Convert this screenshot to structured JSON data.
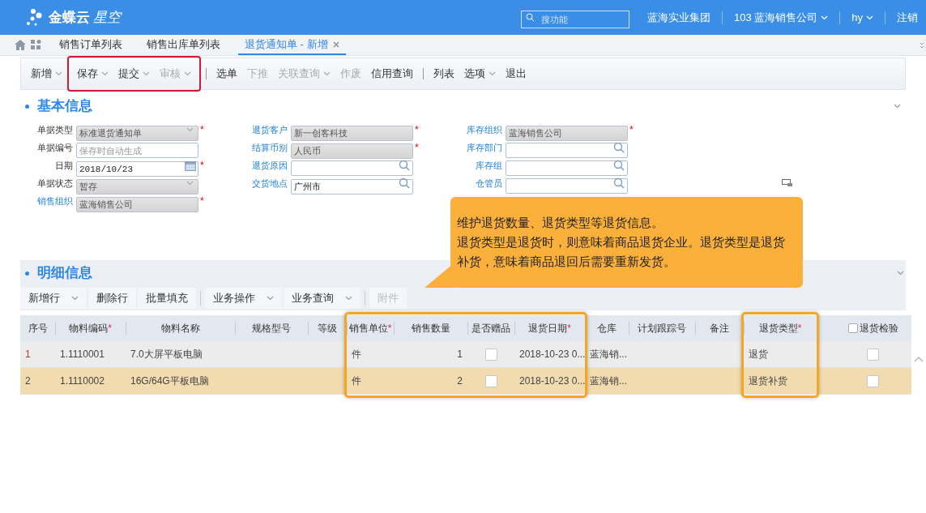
{
  "topbar": {
    "brand": "金蝶云",
    "brand_suffix": "星空",
    "search": {
      "placeholder": "搜功能"
    },
    "group": "蓝海实业集团",
    "org": "103 蓝海销售公司",
    "user": "hy",
    "logout": "注销"
  },
  "tabs": [
    {
      "label": "销售订单列表",
      "selected": false,
      "closable": false
    },
    {
      "label": "销售出库单列表",
      "selected": false,
      "closable": false
    },
    {
      "label": "退货通知单 - 新增",
      "selected": true,
      "closable": true
    }
  ],
  "toolbar": [
    {
      "buttons": [
        {
          "label": "新增",
          "dropdown": true,
          "disabled": false,
          "highlighted": false
        },
        {
          "label": "保存",
          "dropdown": true,
          "disabled": false,
          "highlighted": true
        },
        {
          "label": "提交",
          "dropdown": true,
          "disabled": false,
          "highlighted": true
        },
        {
          "label": "审核",
          "dropdown": true,
          "disabled": true,
          "highlighted": true
        }
      ]
    },
    {
      "buttons": [
        {
          "label": "选单",
          "dropdown": false,
          "disabled": false,
          "highlighted": false
        },
        {
          "label": "下推",
          "dropdown": false,
          "disabled": true,
          "highlighted": false
        },
        {
          "label": "关联查询",
          "dropdown": true,
          "disabled": true,
          "highlighted": false
        },
        {
          "label": "作废",
          "dropdown": false,
          "disabled": true,
          "highlighted": false
        },
        {
          "label": "信用查询",
          "dropdown": false,
          "disabled": false,
          "highlighted": false
        }
      ]
    },
    {
      "buttons": [
        {
          "label": "列表",
          "dropdown": false,
          "disabled": false,
          "highlighted": false
        },
        {
          "label": "选项",
          "dropdown": true,
          "disabled": false,
          "highlighted": false
        },
        {
          "label": "退出",
          "dropdown": false,
          "disabled": false,
          "highlighted": false
        }
      ]
    }
  ],
  "basic_section": {
    "title": "基本信息",
    "columns": [
      [
        {
          "label": "单据类型",
          "link": false,
          "kind": "select",
          "value": "标准退货通知单",
          "disabled": true,
          "required_mark": "*"
        },
        {
          "label": "单据编号",
          "link": false,
          "kind": "text",
          "placeholder": "保存时自动生成",
          "disabled": false
        },
        {
          "label": "日期",
          "link": false,
          "kind": "date",
          "value": "2018/10/23",
          "disabled": false,
          "required_mark": "*"
        },
        {
          "label": "单据状态",
          "link": false,
          "kind": "select",
          "value": "暂存",
          "disabled": true
        },
        {
          "label": "销售组织",
          "link": true,
          "kind": "text",
          "value": "蓝海销售公司",
          "disabled": true,
          "required_mark": "*"
        }
      ],
      [
        {
          "label": "退货客户",
          "link": true,
          "kind": "text",
          "value": "新一创客科技",
          "disabled": true,
          "required_mark": "*"
        },
        {
          "label": "结算币别",
          "link": true,
          "kind": "text",
          "value": "人民币",
          "disabled": true,
          "required_mark": "*"
        },
        {
          "label": "退货原因",
          "link": true,
          "kind": "lookup",
          "disabled": false
        },
        {
          "label": "交货地点",
          "link": true,
          "kind": "lookup",
          "value": "广州市",
          "disabled": false
        }
      ],
      [
        {
          "label": "库存组织",
          "link": true,
          "kind": "text",
          "value": "蓝海销售公司",
          "disabled": true,
          "required_mark": "*"
        },
        {
          "label": "库存部门",
          "link": true,
          "kind": "lookup",
          "disabled": false
        },
        {
          "label": "库存组",
          "link": true,
          "kind": "lookup",
          "disabled": false
        },
        {
          "label": "仓管员",
          "link": true,
          "kind": "lookup",
          "disabled": false
        }
      ]
    ]
  },
  "tooltip": {
    "lines": [
      "维护退货数量、退货类型等退货信息。",
      "退货类型是退货时，则意味着商品退货企业。退货类型是退货补货，意味着商品退回后需要重新发货。"
    ]
  },
  "detail_section": {
    "title": "明细信息",
    "toolbar": [
      {
        "buttons": [
          {
            "label": "新增行",
            "dropdown": true,
            "disabled": false
          },
          {
            "label": "删除行",
            "dropdown": false,
            "disabled": false
          },
          {
            "label": "批量填充",
            "dropdown": false,
            "disabled": false
          }
        ]
      },
      {
        "buttons": [
          {
            "label": "业务操作",
            "dropdown": true,
            "disabled": false
          },
          {
            "label": "业务查询",
            "dropdown": true,
            "disabled": false
          }
        ]
      },
      {
        "buttons": [
          {
            "label": "附件",
            "dropdown": false,
            "disabled": true
          }
        ]
      }
    ],
    "table": {
      "columns": [
        {
          "label": "序号",
          "kind": "text",
          "highlighted": false
        },
        {
          "label": "物料编码",
          "required_mark": "*",
          "kind": "text",
          "highlighted": false
        },
        {
          "label": "物料名称",
          "kind": "text",
          "highlighted": false
        },
        {
          "label": "规格型号",
          "kind": "text",
          "highlighted": false
        },
        {
          "label": "等级",
          "kind": "text",
          "highlighted": false
        },
        {
          "label": "销售单位",
          "required_mark": "*",
          "kind": "text",
          "highlighted": true
        },
        {
          "label": "销售数量",
          "kind": "number",
          "highlighted": true
        },
        {
          "label": "是否赠品",
          "kind": "check",
          "highlighted": true
        },
        {
          "label": "退货日期",
          "required_mark": "*",
          "kind": "text",
          "highlighted": true
        },
        {
          "label": "仓库",
          "kind": "text",
          "highlighted": false
        },
        {
          "label": "计划跟踪号",
          "kind": "text",
          "highlighted": false
        },
        {
          "label": "备注",
          "kind": "text",
          "highlighted": false
        },
        {
          "label": "退货类型",
          "required_mark": "*",
          "kind": "text",
          "highlighted": true
        },
        {
          "kind": "text"
        },
        {
          "label": "退货检验",
          "kind": "check",
          "highlighted": false,
          "header_checked": false
        }
      ],
      "rows": [
        {
          "selected": false,
          "cells": [
            "1",
            "1.1110001",
            "7.0大屏平板电脑",
            null,
            null,
            "件",
            "1",
            false,
            "2018-10-23 0...",
            "蓝海销...",
            null,
            null,
            "退货",
            null,
            false
          ]
        },
        {
          "selected": true,
          "cells": [
            "2",
            "1.1110002",
            "16G/64G平板电脑",
            null,
            null,
            "件",
            "2",
            false,
            "2018-10-23 0...",
            "蓝海销...",
            null,
            null,
            "退货补货",
            null,
            false
          ]
        }
      ]
    }
  }
}
